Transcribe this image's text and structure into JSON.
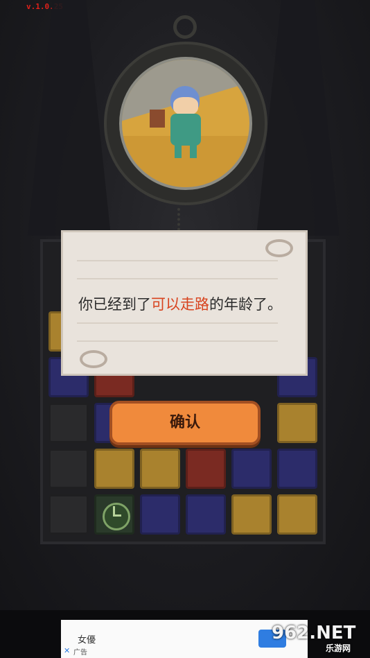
{
  "version": "v.1.0.25",
  "dialog": {
    "prefix": "你已经到了",
    "highlight": "可以走路",
    "suffix": "的年龄了。"
  },
  "confirm_label": "确认",
  "ad": {
    "title": "女優",
    "label": "广告",
    "close": "✕"
  },
  "watermark": {
    "main": "962.NET",
    "sub": "乐游网"
  },
  "colors": {
    "highlight": "#d8431e",
    "button": "#f08a3c",
    "version": "#e0201a"
  }
}
